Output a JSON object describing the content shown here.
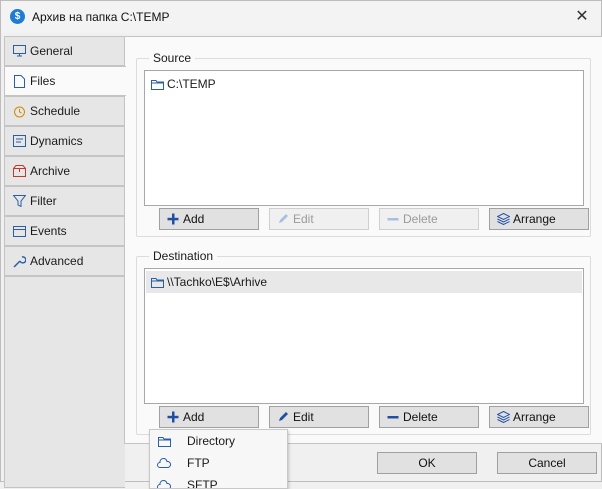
{
  "window": {
    "title": "Архив на папка C:\\TEMP",
    "close_glyph": "✕"
  },
  "tabs": [
    {
      "label": "General",
      "icon": "monitor-icon"
    },
    {
      "label": "Files",
      "icon": "file-icon",
      "active": true
    },
    {
      "label": "Schedule",
      "icon": "alarm-clock-icon"
    },
    {
      "label": "Dynamics",
      "icon": "dynamics-icon"
    },
    {
      "label": "Archive",
      "icon": "archive-box-icon"
    },
    {
      "label": "Filter",
      "icon": "filter-icon"
    },
    {
      "label": "Events",
      "icon": "calendar-icon"
    },
    {
      "label": "Advanced",
      "icon": "wrench-icon"
    }
  ],
  "source": {
    "title": "Source",
    "items": [
      "C:\\TEMP"
    ],
    "buttons": {
      "add": "Add",
      "edit": "Edit",
      "delete": "Delete",
      "arrange": "Arrange"
    }
  },
  "destination": {
    "title": "Destination",
    "items": [
      "\\\\Tachko\\E$\\Arhive"
    ],
    "buttons": {
      "add": "Add",
      "edit": "Edit",
      "delete": "Delete",
      "arrange": "Arrange"
    }
  },
  "footer": {
    "ok": "OK",
    "cancel": "Cancel"
  },
  "add_menu": [
    {
      "label": "Directory",
      "icon": "folder-icon"
    },
    {
      "label": "FTP",
      "icon": "cloud-icon"
    },
    {
      "label": "SFTP",
      "icon": "cloud-lock-icon"
    }
  ],
  "colors": {
    "accent": "#2a5fa8",
    "app_icon": "#1e7bd6"
  }
}
